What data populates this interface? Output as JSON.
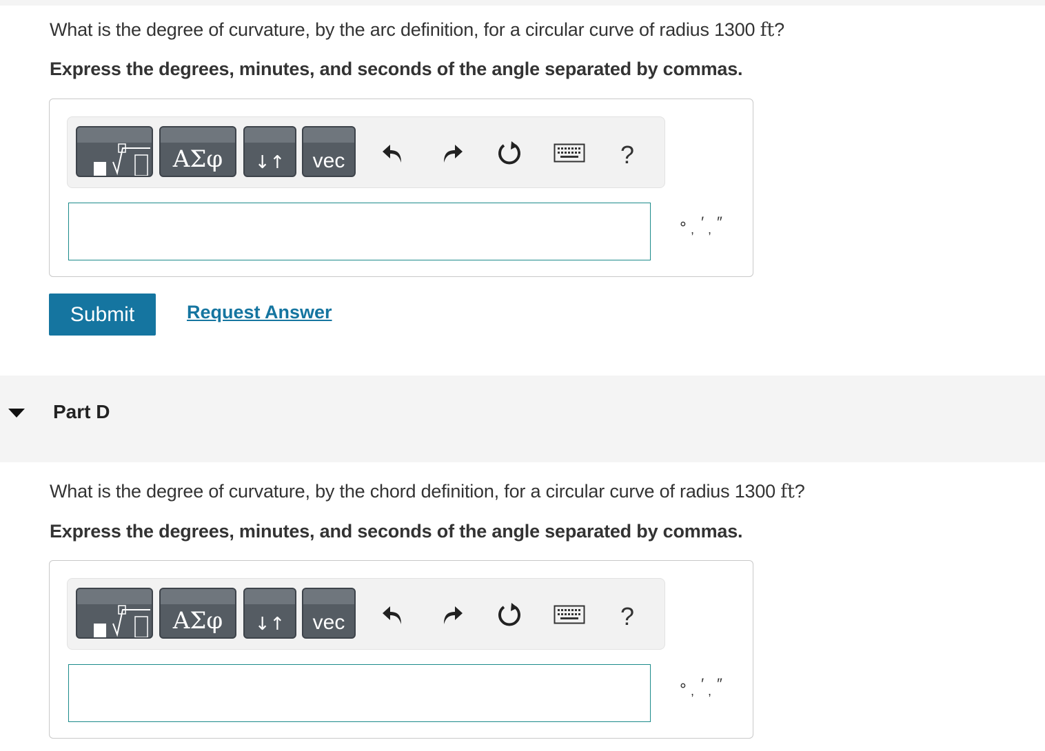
{
  "part_c": {
    "question_text": "What is the degree of curvature, by the arc definition, for a circular curve of radius 1300 ",
    "question_unit": "ft",
    "question_end": "?",
    "instruction": "Express the degrees, minutes, and seconds of the angle separated by commas.",
    "answer_value": "",
    "submit_label": "Submit",
    "request_answer_label": "Request Answer"
  },
  "part_d": {
    "header": "Part D",
    "question_text": "What is the degree of curvature, by the chord definition, for a circular curve of radius 1300 ",
    "question_unit": "ft",
    "question_end": "?",
    "instruction": "Express the degrees, minutes, and seconds of the angle separated by commas.",
    "answer_value": ""
  },
  "toolbar": {
    "greek_label": "ΑΣφ",
    "vec_label": "vec",
    "arrows_label": "↓↑",
    "help_label": "?",
    "icons": [
      "templates-icon",
      "greek-symbols-icon",
      "subscript-superscript-icon",
      "vector-icon",
      "undo-icon",
      "redo-icon",
      "reset-icon",
      "keyboard-icon",
      "help-icon"
    ]
  },
  "units_symbols": {
    "degree": "∘",
    "minute": "′",
    "second": "″",
    "separator": ","
  },
  "colors": {
    "accent": "#1575a0",
    "input_border": "#1a8a8a",
    "button_bg": "#555c63",
    "header_bg": "#f4f4f4"
  }
}
